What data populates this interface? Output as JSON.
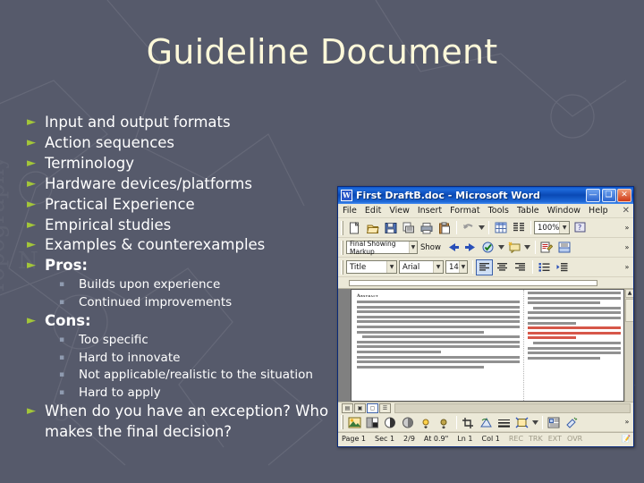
{
  "slide": {
    "title": "Guideline Document",
    "background_color": "#565A6B",
    "title_color": "#FDF8D9",
    "bullet_color": "#A3C639",
    "subbullet_color": "#8F9BB0",
    "bullet_glyph": "►",
    "subbullet_glyph": "▪",
    "items": [
      {
        "level": 1,
        "text": "Input and output formats",
        "bold": false
      },
      {
        "level": 1,
        "text": "Action sequences",
        "bold": false
      },
      {
        "level": 1,
        "text": "Terminology",
        "bold": false
      },
      {
        "level": 1,
        "text": "Hardware devices/platforms",
        "bold": false
      },
      {
        "level": 1,
        "text": "Practical Experience",
        "bold": false
      },
      {
        "level": 1,
        "text": "Empirical studies",
        "bold": false
      },
      {
        "level": 1,
        "text": "Examples & counterexamples",
        "bold": false
      },
      {
        "level": 1,
        "text": "Pros:",
        "bold": true
      },
      {
        "level": 2,
        "text": "Builds upon experience",
        "bold": false
      },
      {
        "level": 2,
        "text": "Continued improvements",
        "bold": false
      },
      {
        "level": 1,
        "text": "Cons:",
        "bold": true
      },
      {
        "level": 2,
        "text": "Too specific",
        "bold": false
      },
      {
        "level": 2,
        "text": "Hard to innovate",
        "bold": false
      },
      {
        "level": 2,
        "text": "Not applicable/realistic to the situation",
        "bold": false
      },
      {
        "level": 2,
        "text": "Hard to apply",
        "bold": false
      },
      {
        "level": 1,
        "text": "When do you have an exception?  Who makes the final decision?",
        "bold": false
      }
    ]
  },
  "word": {
    "title": "First DraftB.doc - Microsoft Word",
    "app_icon": "word-document-icon",
    "window_buttons": {
      "minimize": "—",
      "maximize": "❑",
      "close": "✕"
    },
    "menu": {
      "items": [
        "File",
        "Edit",
        "View",
        "Insert",
        "Format",
        "Tools",
        "Table",
        "Window",
        "Help"
      ],
      "close_document": "✕"
    },
    "standard_toolbar": {
      "icons": [
        "new-document-icon",
        "open-folder-icon",
        "save-disk-icon",
        "print-preview-icon",
        "print-icon",
        "paste-clipboard-icon",
        "undo-icon",
        "insert-table-icon",
        "columns-icon",
        "help-icon"
      ],
      "zoom_value": "100%",
      "overflow": "»"
    },
    "reviewing_toolbar": {
      "display_mode": "Final Showing Markup",
      "show_label": "Show",
      "icons": [
        "previous-change-icon",
        "next-change-icon",
        "accept-change-icon",
        "new-comment-icon",
        "track-changes-icon",
        "reviewing-pane-icon"
      ],
      "overflow": "»"
    },
    "formatting_toolbar": {
      "style": "Title",
      "font": "Arial",
      "font_size": "14",
      "icons": [
        "align-left-icon",
        "align-center-icon",
        "align-right-icon",
        "bullets-icon",
        "increase-indent-icon"
      ],
      "overflow": "»"
    },
    "document": {
      "heading": "Abstract",
      "body_preview": "In this paper we present feedback from a group of medical students who experienced an immersive virtual patient system to practice diagnosis skills. They interacted naturally with projector-based life sized virtual characters using gesture, speech. We believe that natural interaction and a high level of immersion will facilitate education of communication skills.",
      "margin_preview": "report, and then gradually told experience, Researchers have cap social simulations to pedagogical and tutoring agents.",
      "has_tracked_changes": true
    },
    "view_buttons": [
      "normal-view-icon",
      "web-layout-view-icon",
      "print-layout-view-icon",
      "outline-view-icon"
    ],
    "picture_toolbar": {
      "icons": [
        "insert-picture-icon",
        "color-icon",
        "more-contrast-icon",
        "less-contrast-icon",
        "more-brightness-icon",
        "less-brightness-icon",
        "crop-icon",
        "rotate-left-icon",
        "line-style-icon",
        "compress-picture-icon",
        "text-wrapping-icon",
        "format-picture-icon",
        "set-transparent-color-icon"
      ],
      "overflow": "»"
    },
    "status_bar": {
      "page": "Page 1",
      "section": "Sec 1",
      "page_of": "2/9",
      "at": "At 0.9\"",
      "line": "Ln 1",
      "column": "Col 1",
      "indicators": [
        "REC",
        "TRK",
        "EXT",
        "OVR"
      ],
      "language_icon": "spelling-status-icon"
    }
  }
}
